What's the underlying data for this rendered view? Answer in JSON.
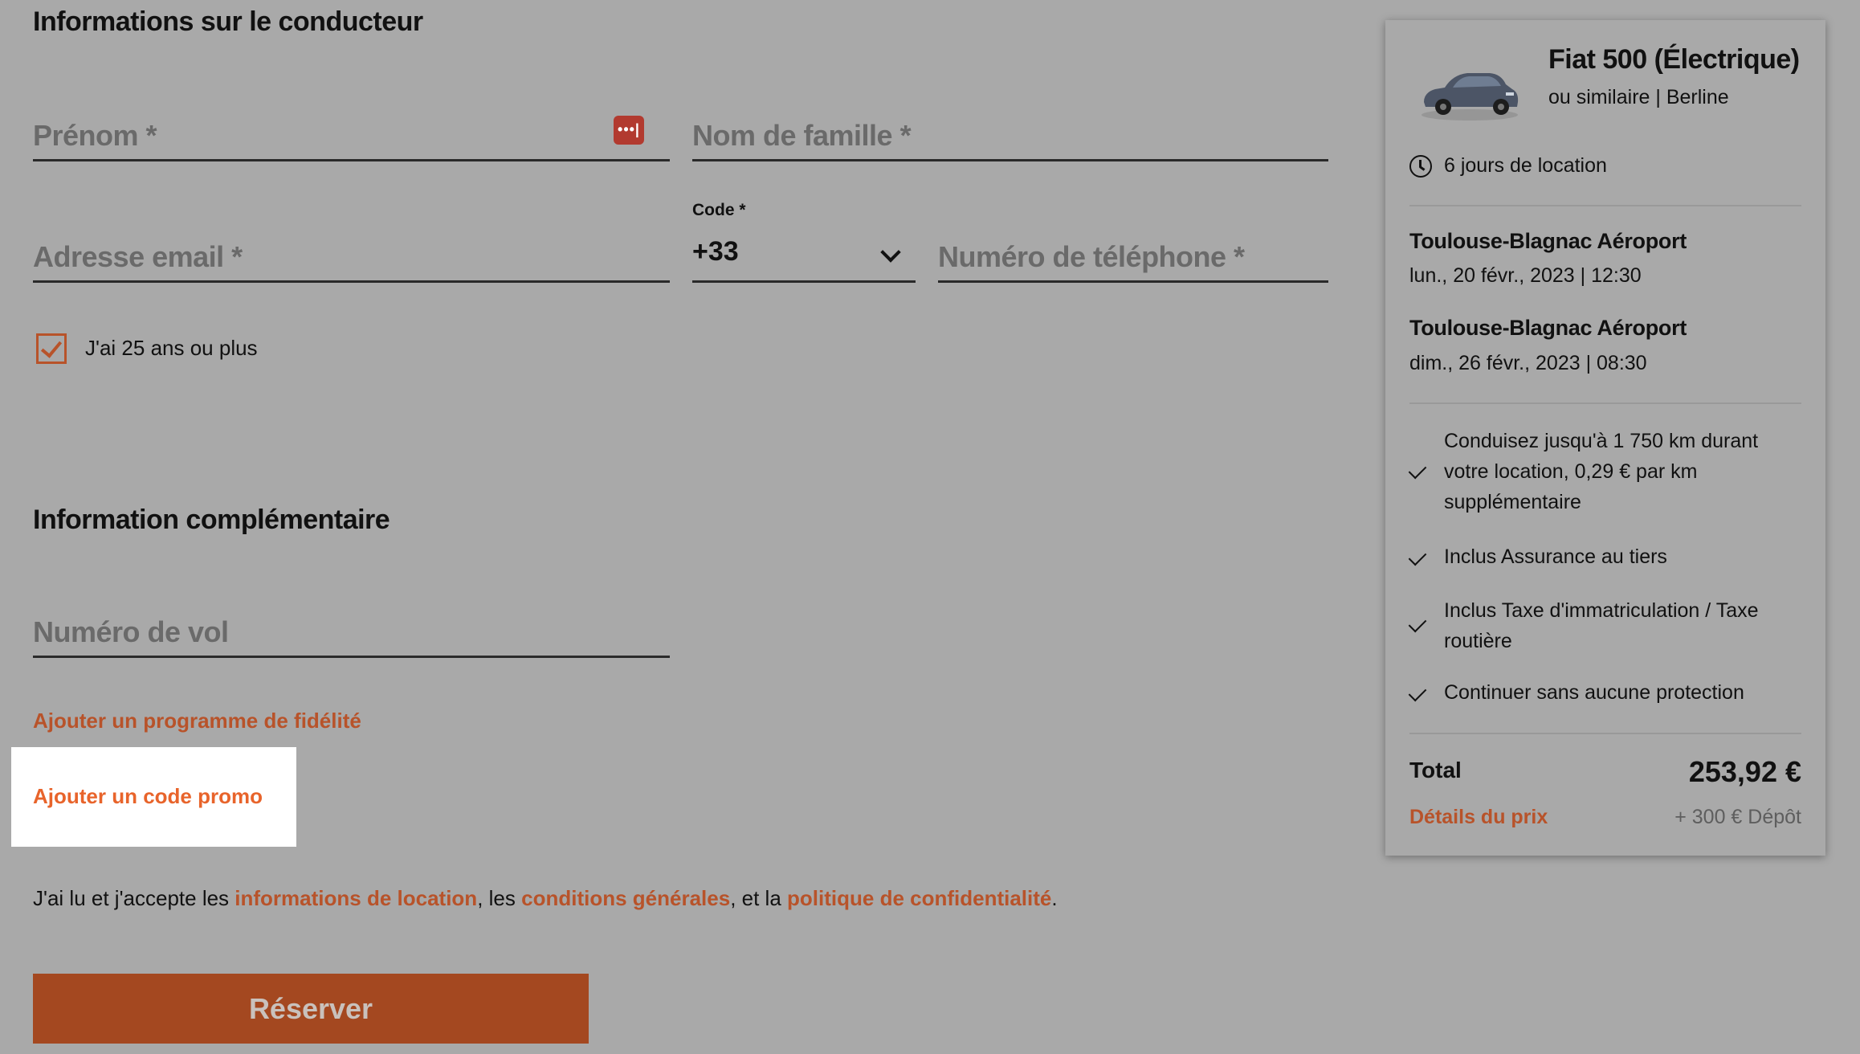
{
  "driver_section": {
    "title": "Informations sur le conducteur",
    "first_name_placeholder": "Prénom *",
    "password_manager_icon": "•••|",
    "last_name_placeholder": "Nom de famille *",
    "email_placeholder": "Adresse email *",
    "code_label": "Code *",
    "code_value": "+33",
    "phone_placeholder": "Numéro de téléphone *",
    "age_checkbox_label": "J'ai 25 ans ou plus",
    "age_checkbox_checked": true
  },
  "extra_section": {
    "title": "Information complémentaire",
    "flight_placeholder": "Numéro de vol",
    "loyalty_link": "Ajouter un programme de fidélité",
    "promo_link": "Ajouter un code promo"
  },
  "terms": {
    "prefix": "J'ai lu et j'accepte les ",
    "link1": "informations de location",
    "sep1": ", les ",
    "link2": "conditions générales",
    "sep2": ", et la ",
    "link3": "politique de confidentialité",
    "suffix": "."
  },
  "reserve_button": "Réserver",
  "summary": {
    "car_name": "Fiat 500 (Électrique)",
    "car_category": "ou similaire | Berline",
    "duration": "6 jours de location",
    "pickup_location": "Toulouse-Blagnac Aéroport",
    "pickup_date": "lun., 20 févr., 2023 | 12:30",
    "dropoff_location": "Toulouse-Blagnac Aéroport",
    "dropoff_date": "dim., 26 févr., 2023 | 08:30",
    "features": [
      "Conduisez jusqu'à 1 750 km durant votre location, 0,29 € par km supplémentaire",
      "Inclus Assurance au tiers",
      "Inclus Taxe d'immatriculation / Taxe routière",
      "Continuer sans aucune protection"
    ],
    "total_label": "Total",
    "total_value": "253,92 €",
    "price_details_link": "Détails du prix",
    "deposit": "+ 300 € Dépôt"
  },
  "colors": {
    "accent": "#b8532a",
    "button": "#a44820",
    "promo_link": "#e8642b",
    "background": "#a9a9a9"
  }
}
